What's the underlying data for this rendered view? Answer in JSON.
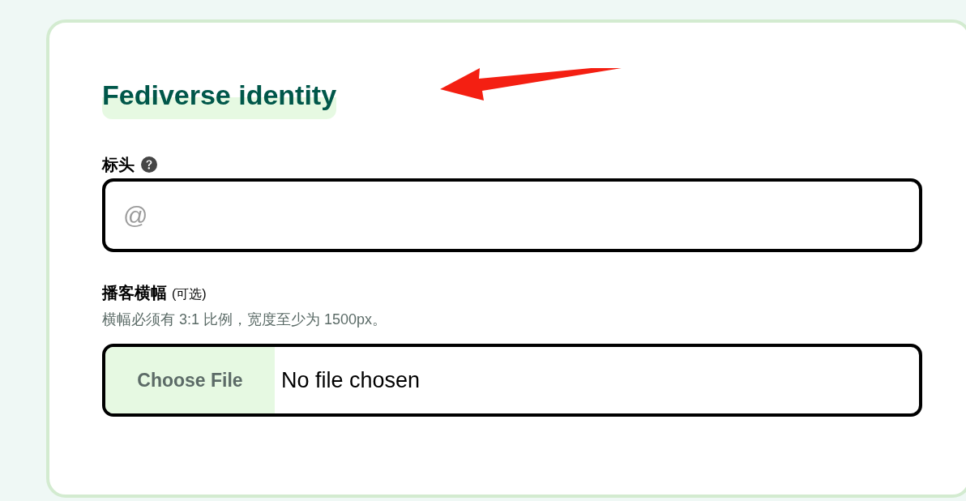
{
  "section": {
    "title": "Fediverse identity"
  },
  "fields": [
    {
      "kind": "text",
      "label": "标头",
      "help": true,
      "placeholder": "@"
    },
    {
      "kind": "file",
      "label": "播客横幅",
      "note": "(可选)",
      "hint": "横幅必须有 3:1 比例，宽度至少为 1500px。",
      "button": "Choose File",
      "status": "No file chosen"
    }
  ]
}
